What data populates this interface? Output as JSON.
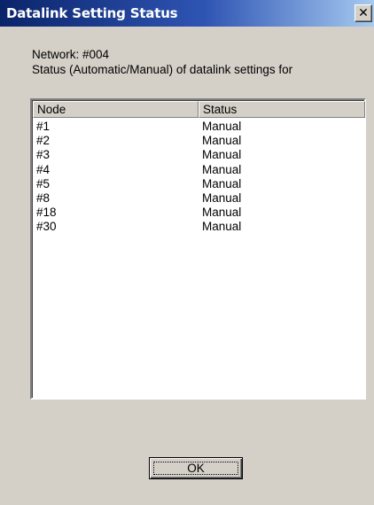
{
  "window": {
    "title": "Datalink Setting Status",
    "close_glyph": "✕"
  },
  "info": {
    "network": "Network: #004",
    "status_desc": "Status (Automatic/Manual) of datalink settings for"
  },
  "list": {
    "columns": [
      "Node",
      "Status"
    ],
    "rows": [
      {
        "node": "#1",
        "status": "Manual"
      },
      {
        "node": "#2",
        "status": "Manual"
      },
      {
        "node": "#3",
        "status": "Manual"
      },
      {
        "node": "#4",
        "status": "Manual"
      },
      {
        "node": "#5",
        "status": "Manual"
      },
      {
        "node": "#8",
        "status": "Manual"
      },
      {
        "node": "#18",
        "status": "Manual"
      },
      {
        "node": "#30",
        "status": "Manual"
      }
    ]
  },
  "buttons": {
    "ok_label": "OK"
  }
}
